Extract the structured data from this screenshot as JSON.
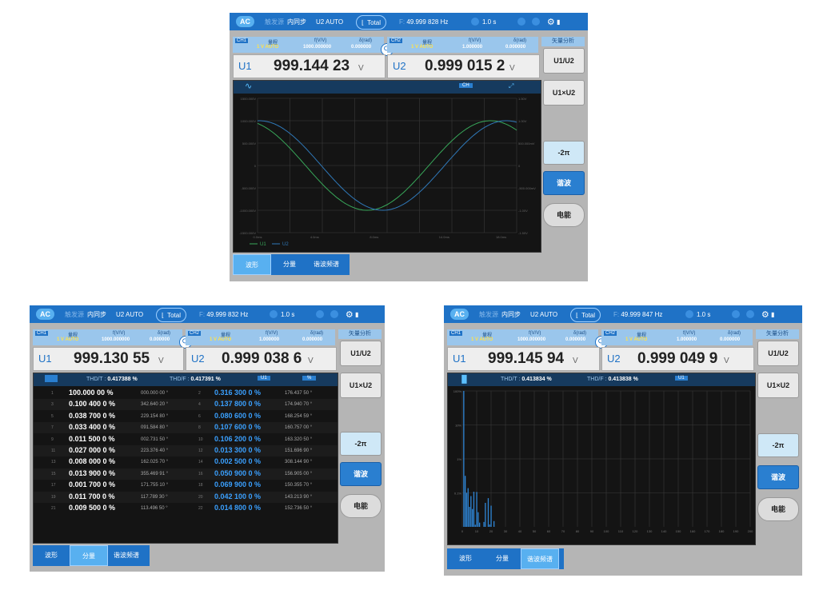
{
  "common": {
    "ac": "AC",
    "trigger_label": "触发源",
    "trigger_value": "内同步",
    "u2_auto": "U2 AUTO",
    "total": "Total",
    "freq_prefix": "F:",
    "time": "1.0 s",
    "ch1": "CH1",
    "ch2": "CH2",
    "range_label": "量程",
    "fvv_label": "f(V/V)",
    "drad_label": "δ(rad)",
    "range_value": "1 V AUTO",
    "ch1_fvv": "1000.000000",
    "ch1_drad": "0.000000",
    "ch2_fvv": "1.000000",
    "ch2_drad": "0.000000",
    "u1": "U1",
    "u2": "U2",
    "unit_v": "V",
    "side_title": "矢量分析",
    "btn_u1u2": "U1/U2",
    "btn_u1xu2": "U1×U2",
    "btn_2pi": "-2π",
    "btn_harmonic": "谐波",
    "btn_energy": "电能",
    "tab_wave": "波形",
    "tab_component": "分量",
    "tab_spectrum": "谐波频谱"
  },
  "panel1": {
    "freq": "49.999 828 Hz",
    "u1_value": "999.144 23",
    "u2_value": "0.999 015 2",
    "ch_badge": "CH",
    "y_left": [
      "1500.000V",
      "1000.000V",
      "500.000V",
      "0",
      "-500.000V",
      "-1000.000V",
      "-1500.000V"
    ],
    "y_right": [
      "1.50V",
      "1.00V",
      "500.000mV",
      "0",
      "-500.000mV",
      "-1.00V",
      "-1.50V"
    ],
    "x_ticks": [
      "0.0ms",
      "4.0ms",
      "8.0ms",
      "14.0ms",
      "18.0ms"
    ],
    "legend": [
      "U1",
      "U2"
    ]
  },
  "panel2": {
    "freq": "49.999 832 Hz",
    "u1_value": "999.130 55",
    "u2_value": "0.999 038 6",
    "thd_t_label": "THD/T :",
    "thd_t": "0.417388 %",
    "thd_f_label": "THD/F :",
    "thd_f": "0.417391 %",
    "u1_badge": "U1",
    "pct_badge": "%",
    "rows": [
      [
        "1",
        "100.000 00 %",
        "000.000 00 °",
        "2",
        "0.316 300 0 %",
        "176.437 50 °"
      ],
      [
        "3",
        "0.100 400 0 %",
        "342.640 20 °",
        "4",
        "0.137 800 0 %",
        "174.940 70 °"
      ],
      [
        "5",
        "0.038 700 0 %",
        "229.154 80 °",
        "6",
        "0.080 600 0 %",
        "168.254 59 °"
      ],
      [
        "7",
        "0.033 400 0 %",
        "091.584 80 °",
        "8",
        "0.107 600 0 %",
        "160.757 00 °"
      ],
      [
        "9",
        "0.011 500 0 %",
        "002.731 50 °",
        "10",
        "0.106 200 0 %",
        "163.320 50 °"
      ],
      [
        "11",
        "0.027 000 0 %",
        "223.376 40 °",
        "12",
        "0.013 300 0 %",
        "151.696 90 °"
      ],
      [
        "13",
        "0.008 000 0 %",
        "162.025 70 °",
        "14",
        "0.002 500 0 %",
        "308.144 90 °"
      ],
      [
        "15",
        "0.013 900 0 %",
        "355.469 91 °",
        "16",
        "0.050 900 0 %",
        "156.905 00 °"
      ],
      [
        "17",
        "0.001 700 0 %",
        "171.755 10 °",
        "18",
        "0.069 900 0 %",
        "150.355 70 °"
      ],
      [
        "19",
        "0.011 700 0 %",
        "117.789 30 °",
        "20",
        "0.042 100 0 %",
        "143.213 90 °"
      ],
      [
        "21",
        "0.009 500 0 %",
        "113.496 50 °",
        "22",
        "0.014 800 0 %",
        "152.736 50 °"
      ]
    ]
  },
  "panel3": {
    "freq": "49.999 847 Hz",
    "u1_value": "999.145 94",
    "u2_value": "0.999 049 9",
    "thd_t_label": "THD/T :",
    "thd_t": "0.413834 %",
    "thd_f_label": "THD/F :",
    "thd_f": "0.413838 %",
    "u1_badge": "U1",
    "y_labels": [
      "100%",
      "10%",
      "1%",
      "0.1%"
    ],
    "x_labels": [
      "0",
      "10",
      "20",
      "30",
      "40",
      "50",
      "60",
      "70",
      "80",
      "90",
      "100",
      "110",
      "120",
      "130",
      "140",
      "150",
      "160",
      "170",
      "180",
      "190",
      "200"
    ]
  },
  "chart_data": {
    "type": "bar",
    "log_scale": true,
    "ylim": [
      0.01,
      100
    ],
    "xlim": [
      0,
      200
    ],
    "x": [
      1,
      2,
      3,
      4,
      5,
      6,
      7,
      8,
      9,
      10,
      11,
      12,
      13,
      14,
      15,
      16,
      17,
      18,
      19,
      20,
      21,
      22
    ],
    "values": [
      100.0,
      0.3163,
      0.1004,
      0.1378,
      0.0387,
      0.0806,
      0.0334,
      0.1076,
      0.0115,
      0.1062,
      0.027,
      0.0133,
      0.008,
      0.0025,
      0.0139,
      0.0509,
      0.0017,
      0.0699,
      0.0117,
      0.0421,
      0.0095,
      0.0148
    ]
  }
}
